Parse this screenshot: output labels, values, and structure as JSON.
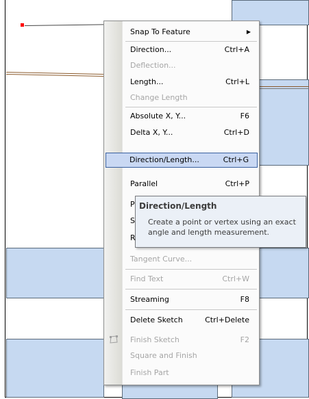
{
  "menu": {
    "items": [
      {
        "label": "Snap To Feature",
        "shortcut": "",
        "disabled": false,
        "submenu": true
      },
      {
        "label": "Direction...",
        "shortcut": "Ctrl+A",
        "disabled": false
      },
      {
        "label": "Deflection...",
        "shortcut": "",
        "disabled": true
      },
      {
        "label": "Length...",
        "shortcut": "Ctrl+L",
        "disabled": false
      },
      {
        "label": "Change Length",
        "shortcut": "",
        "disabled": true
      },
      {
        "label": "Absolute X, Y...",
        "shortcut": "F6",
        "disabled": false
      },
      {
        "label": "Delta X, Y...",
        "shortcut": "Ctrl+D",
        "disabled": false
      },
      {
        "label": "Direction/Length...",
        "shortcut": "Ctrl+G",
        "disabled": false,
        "highlighted": true
      },
      {
        "label": "Parallel",
        "shortcut": "Ctrl+P",
        "disabled": false
      },
      {
        "label": "P",
        "shortcut": "",
        "disabled": false
      },
      {
        "label": "S",
        "shortcut": "",
        "disabled": false
      },
      {
        "label": "R",
        "shortcut": "",
        "disabled": false
      },
      {
        "label": "Tangent Curve...",
        "shortcut": "",
        "disabled": true
      },
      {
        "label": "Find Text",
        "shortcut": "Ctrl+W",
        "disabled": true
      },
      {
        "label": "Streaming",
        "shortcut": "F8",
        "disabled": false
      },
      {
        "label": "Delete Sketch",
        "shortcut": "Ctrl+Delete",
        "disabled": false
      },
      {
        "label": "Finish Sketch",
        "shortcut": "F2",
        "disabled": true,
        "icon": "finish-sketch-icon"
      },
      {
        "label": "Square and Finish",
        "shortcut": "",
        "disabled": true
      },
      {
        "label": "Finish Part",
        "shortcut": "",
        "disabled": true
      }
    ]
  },
  "tooltip": {
    "title": "Direction/Length",
    "body": "Create a point or vertex using an exact angle and length measurement."
  },
  "colors": {
    "parcel": "#c6d9f1",
    "highlight": "#c9d8f3",
    "highlight_border": "#385f9e",
    "vertex": "#ff0000",
    "edge": "#8b5a2b"
  }
}
